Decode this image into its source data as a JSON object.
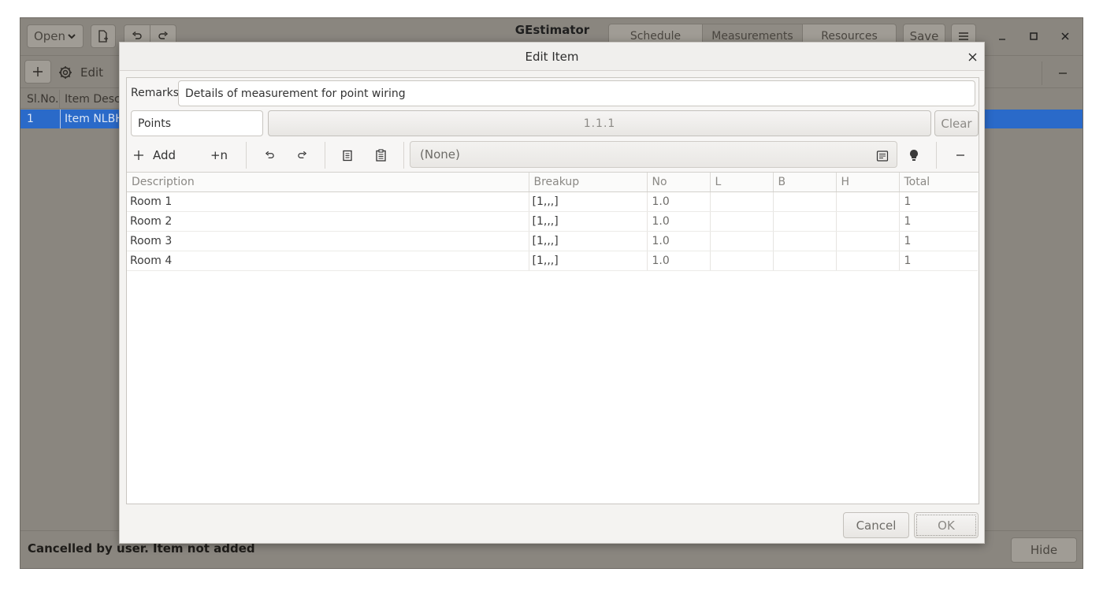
{
  "app": {
    "title": "GEstimator"
  },
  "headerbar": {
    "open_label": "Open",
    "tabs": [
      {
        "label": "Schedule"
      },
      {
        "label": "Measurements"
      },
      {
        "label": "Resources"
      }
    ],
    "save_label": "Save"
  },
  "main_toolbar": {
    "edit_label": "Edit"
  },
  "schedule_table": {
    "columns": [
      "Sl.No.",
      "Item Desc"
    ],
    "rows": [
      {
        "slno": "1",
        "desc": "Item NLBH-"
      }
    ]
  },
  "statusbar": {
    "message": "Cancelled by user. Item not added",
    "hide_label": "Hide"
  },
  "dialog": {
    "title": "Edit Item",
    "remarks_label": "Remarks:",
    "remarks_value": "Details of measurement for point wiring",
    "unit_value": "Points",
    "code_value": "1.1.1",
    "clear_label": "Clear",
    "add_label": "Add",
    "add_n_label": "+n",
    "template_value": "(None)",
    "table": {
      "columns": [
        "Description",
        "Breakup",
        "No",
        "L",
        "B",
        "H",
        "Total"
      ],
      "rows": [
        {
          "description": "Room 1",
          "breakup": "[1,,,]",
          "no": "1.0",
          "l": "",
          "b": "",
          "h": "",
          "total": "1"
        },
        {
          "description": "Room 2",
          "breakup": "[1,,,]",
          "no": "1.0",
          "l": "",
          "b": "",
          "h": "",
          "total": "1"
        },
        {
          "description": "Room 3",
          "breakup": "[1,,,]",
          "no": "1.0",
          "l": "",
          "b": "",
          "h": "",
          "total": "1"
        },
        {
          "description": "Room 4",
          "breakup": "[1,,,]",
          "no": "1.0",
          "l": "",
          "b": "",
          "h": "",
          "total": "1"
        }
      ]
    },
    "cancel_label": "Cancel",
    "ok_label": "OK"
  }
}
